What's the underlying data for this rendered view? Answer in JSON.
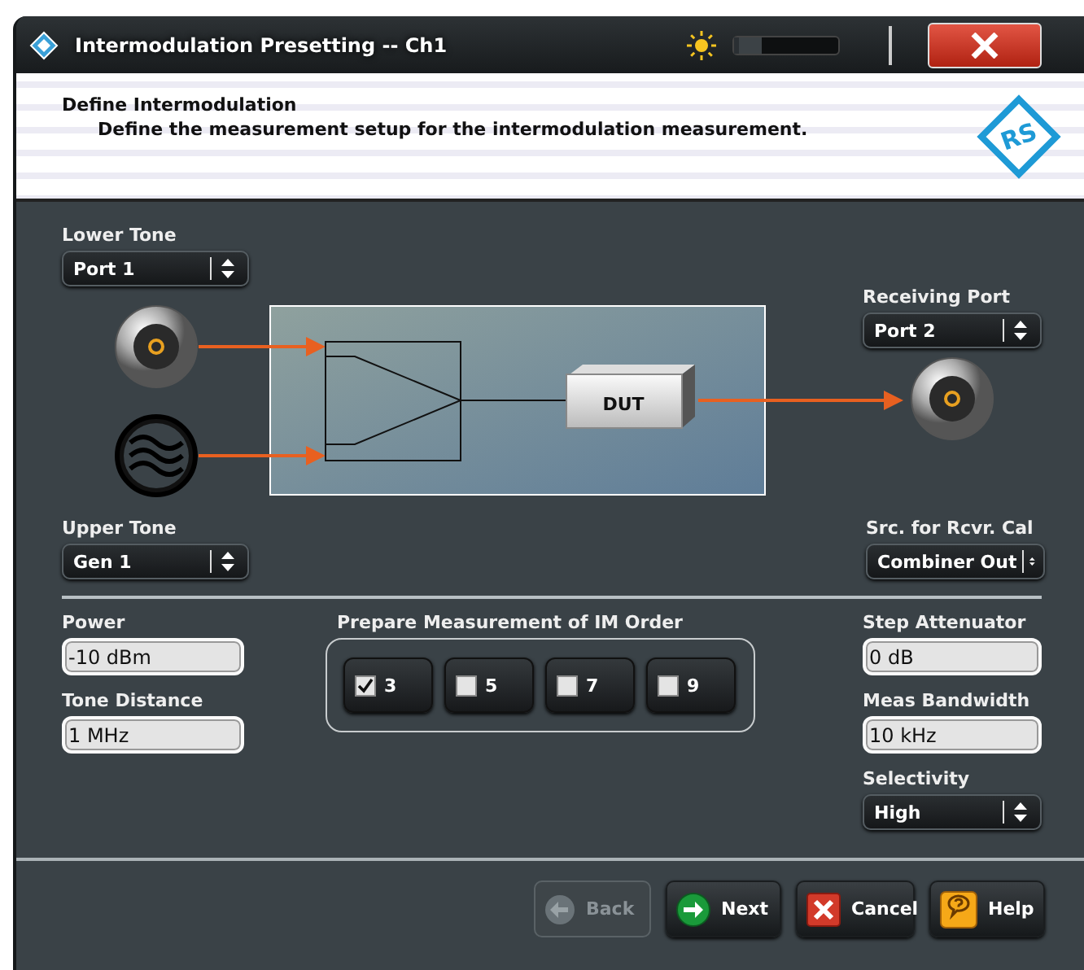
{
  "window": {
    "title": "Intermodulation Presetting -- Ch1",
    "brightness": {
      "level": 0.05
    }
  },
  "header": {
    "title": "Define Intermodulation",
    "subtitle": "Define the measurement setup for the intermodulation measurement.",
    "logo_text": "RS"
  },
  "lower_tone": {
    "label": "Lower Tone",
    "value": "Port 1"
  },
  "receiving_port": {
    "label": "Receiving Port",
    "value": "Port 2"
  },
  "diagram": {
    "dut_label": "DUT"
  },
  "upper_tone": {
    "label": "Upper Tone",
    "value": "Gen 1"
  },
  "receiver_cal_source": {
    "label": "Src. for Rcvr. Cal",
    "value": "Combiner Out"
  },
  "power": {
    "label": "Power",
    "value": "-10 dBm"
  },
  "tone_distance": {
    "label": "Tone Distance",
    "value": "1 MHz"
  },
  "im_order": {
    "label": "Prepare Measurement of IM Order",
    "orders": [
      {
        "label": "3",
        "checked": true
      },
      {
        "label": "5",
        "checked": false
      },
      {
        "label": "7",
        "checked": false
      },
      {
        "label": "9",
        "checked": false
      }
    ]
  },
  "step_attenuator": {
    "label": "Step Attenuator",
    "value": "0 dB"
  },
  "meas_bandwidth": {
    "label": "Meas Bandwidth",
    "value": "10 kHz"
  },
  "selectivity": {
    "label": "Selectivity",
    "value": "High"
  },
  "buttons": [
    {
      "kind": "back",
      "label": "Back",
      "disabled": true
    },
    {
      "kind": "next",
      "label": "Next",
      "disabled": false
    },
    {
      "kind": "cancel",
      "label": "Cancel",
      "disabled": false
    },
    {
      "kind": "help",
      "label": "Help",
      "disabled": false
    }
  ]
}
